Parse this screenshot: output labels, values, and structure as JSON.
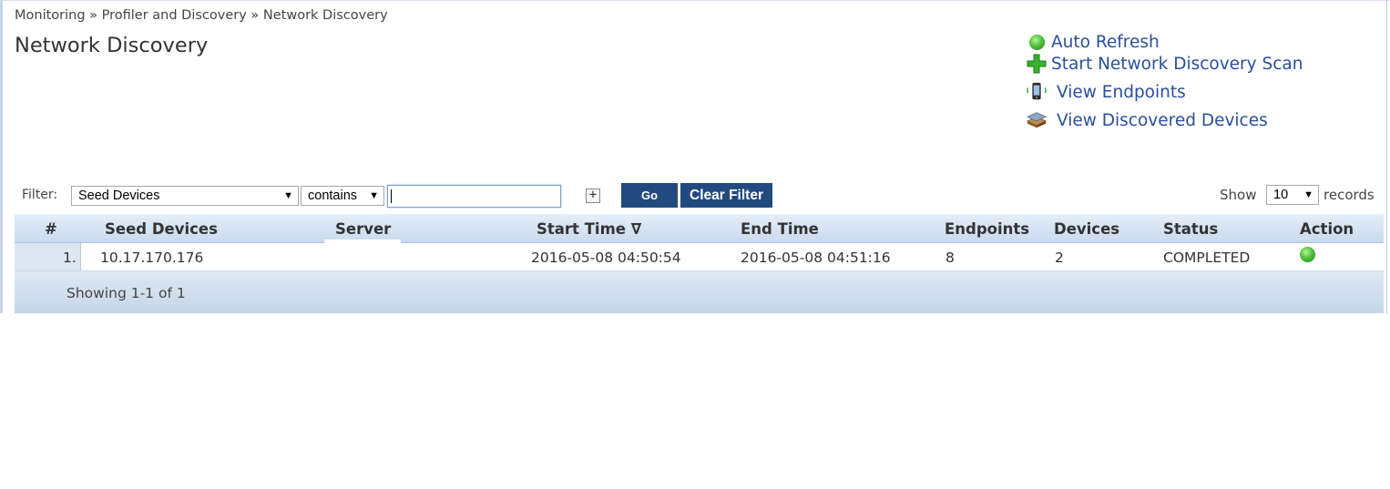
{
  "breadcrumb": "Monitoring » Profiler and Discovery » Network Discovery",
  "title": "Network Discovery",
  "actions": [
    {
      "label": "Auto Refresh",
      "icon": "green-ball-icon"
    },
    {
      "label": "Start Network Discovery Scan",
      "icon": "green-plus-icon"
    },
    {
      "label": "View Endpoints",
      "icon": "mobile-phone-icon"
    },
    {
      "label": "View Discovered Devices",
      "icon": "device-stack-icon"
    }
  ],
  "filter": {
    "label": "Filter:",
    "field": "Seed Devices",
    "operator": "contains",
    "value": "",
    "add_symbol": "+",
    "go_label": "Go",
    "clear_label": "Clear Filter"
  },
  "pagesize": {
    "show_label": "Show",
    "value": "10",
    "records_label": "records"
  },
  "table": {
    "columns": [
      "#",
      "Seed Devices",
      "Server",
      "Start Time ∇",
      "End Time",
      "Endpoints",
      "Devices",
      "Status",
      "Action"
    ],
    "rows": [
      {
        "num": "1.",
        "seed": "10.17.170.176",
        "server": "",
        "start": "2016-05-08 04:50:54",
        "end": "2016-05-08 04:51:16",
        "endpoints": "8",
        "devices": "2",
        "status": "COMPLETED",
        "action_icon": "green-ball-icon"
      }
    ],
    "footer": "Showing 1-1 of 1"
  },
  "colors": {
    "link": "#2a4f9c",
    "button": "#214a7f",
    "header_gradient_top": "#e5eef8",
    "header_gradient_bottom": "#c9daee"
  }
}
